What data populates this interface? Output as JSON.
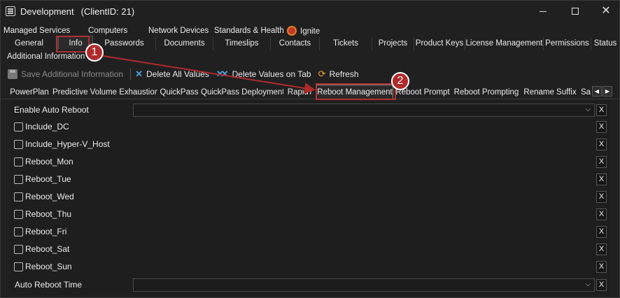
{
  "window": {
    "title": "Development",
    "client_id": "(ClientID: 21)",
    "controls": {
      "minimize": "minimize",
      "maximize": "maximize",
      "close": "✕"
    }
  },
  "tabs_row1": [
    {
      "label": "Managed Services"
    },
    {
      "label": "Computers"
    },
    {
      "label": "Network Devices"
    },
    {
      "label": "Standards & Health"
    },
    {
      "label": "Ignite",
      "icon": "ignite-icon"
    }
  ],
  "tabs_row2": [
    {
      "label": "General"
    },
    {
      "label": "Info",
      "active": true
    },
    {
      "label": "Passwords"
    },
    {
      "label": "Documents"
    },
    {
      "label": "Timeslips"
    },
    {
      "label": "Contacts"
    },
    {
      "label": "Tickets"
    },
    {
      "label": "Projects"
    },
    {
      "label": "Product Keys"
    },
    {
      "label": "License Management"
    },
    {
      "label": "Permissions"
    },
    {
      "label": "Status"
    }
  ],
  "tabs_row3": [
    {
      "label": "Additional Information"
    }
  ],
  "toolbar": {
    "save_label": "Save Additional Information",
    "delete_all_label": "Delete All Values",
    "delete_tab_label": "Delete Values on Tab",
    "refresh_label": "Refresh"
  },
  "subtabs": [
    {
      "label": "PowerPlan"
    },
    {
      "label": "Predictive Volume Exhaustion"
    },
    {
      "label": "QuickPass"
    },
    {
      "label": "QuickPass Deployment"
    },
    {
      "label": "Rapid7"
    },
    {
      "label": "Reboot Management",
      "active": true
    },
    {
      "label": "Reboot Prompt"
    },
    {
      "label": "Reboot Prompting"
    },
    {
      "label": "Rename Suffix"
    },
    {
      "label": "Sa"
    }
  ],
  "form": {
    "enable_auto_reboot_label": "Enable Auto Reboot",
    "auto_reboot_time_label": "Auto Reboot Time",
    "clear_label": "X",
    "checkboxes": [
      {
        "label": "Include_DC",
        "checked": false
      },
      {
        "label": "Include_Hyper-V_Host",
        "checked": false
      },
      {
        "label": "Reboot_Mon",
        "checked": false
      },
      {
        "label": "Reboot_Tue",
        "checked": false
      },
      {
        "label": "Reboot_Wed",
        "checked": false
      },
      {
        "label": "Reboot_Thu",
        "checked": false
      },
      {
        "label": "Reboot_Fri",
        "checked": false
      },
      {
        "label": "Reboot_Sat",
        "checked": false
      },
      {
        "label": "Reboot_Sun",
        "checked": false
      }
    ]
  },
  "annotations": {
    "step1": "1",
    "step2": "2",
    "color": "#b02a2a"
  }
}
